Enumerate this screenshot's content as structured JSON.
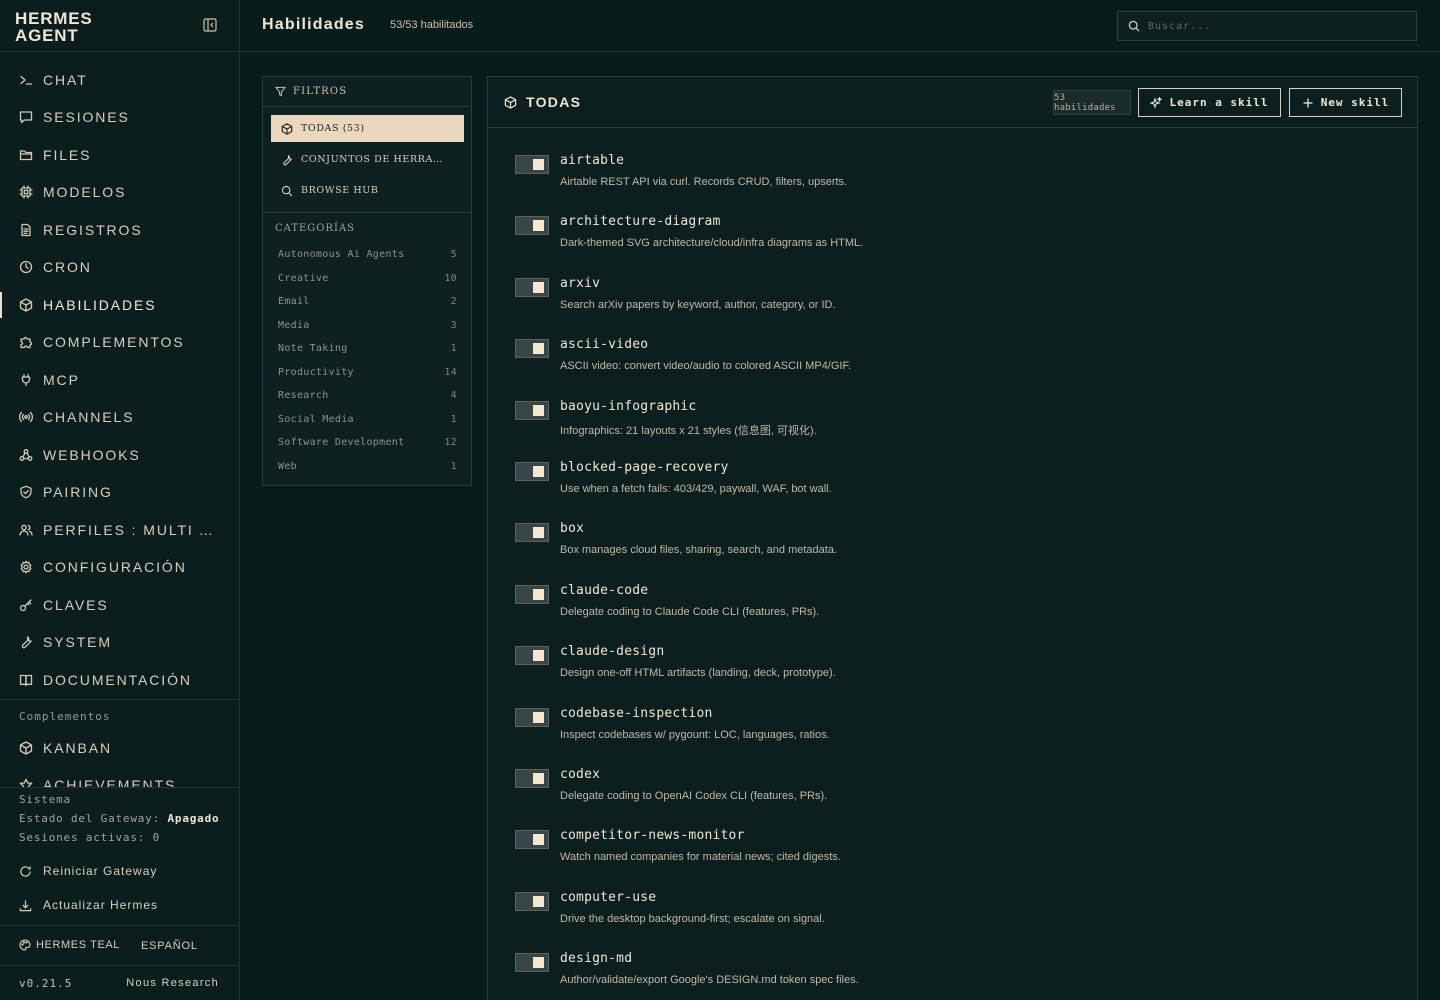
{
  "brand": {
    "line1": "HERMES",
    "line2": "AGENT"
  },
  "nav": [
    {
      "label": "CHAT",
      "icon": "terminal-icon"
    },
    {
      "label": "SESIONES",
      "icon": "message-square-icon"
    },
    {
      "label": "FILES",
      "icon": "folder-icon"
    },
    {
      "label": "MODELOS",
      "icon": "cpu-icon"
    },
    {
      "label": "REGISTROS",
      "icon": "file-text-icon"
    },
    {
      "label": "CRON",
      "icon": "clock-icon"
    },
    {
      "label": "HABILIDADES",
      "icon": "package-icon",
      "active": true
    },
    {
      "label": "COMPLEMENTOS",
      "icon": "puzzle-icon"
    },
    {
      "label": "MCP",
      "icon": "plug-icon"
    },
    {
      "label": "CHANNELS",
      "icon": "radio-icon"
    },
    {
      "label": "WEBHOOKS",
      "icon": "webhook-icon"
    },
    {
      "label": "PAIRING",
      "icon": "shield-check-icon"
    },
    {
      "label": "PERFILES : MULTI AGENTS",
      "icon": "users-icon"
    },
    {
      "label": "CONFIGURACIÓN",
      "icon": "settings-icon"
    },
    {
      "label": "CLAVES",
      "icon": "key-icon"
    },
    {
      "label": "SYSTEM",
      "icon": "wrench-icon"
    },
    {
      "label": "DOCUMENTACIÓN",
      "icon": "book-icon"
    }
  ],
  "plugins": {
    "heading": "Complementos",
    "items": [
      {
        "label": "KANBAN",
        "icon": "package-icon"
      },
      {
        "label": "ACHIEVEMENTS",
        "icon": "star-icon"
      }
    ]
  },
  "system": {
    "heading": "Sistema",
    "gateway_label": "Estado del Gateway:",
    "gateway_value": "Apagado",
    "sessions_label": "Sesiones activas:",
    "sessions_value": "0",
    "restart_label": "Reiniciar Gateway",
    "update_label": "Actualizar Hermes"
  },
  "footer": {
    "theme": "HERMES TEAL",
    "language": "ESPAÑOL",
    "version": "v0.21.5",
    "vendor": "Nous Research"
  },
  "header": {
    "title": "Habilidades",
    "subtitle": "53/53 habilitados",
    "search_placeholder": "Buscar..."
  },
  "filters": {
    "heading": "FILTROS",
    "options": [
      {
        "label": "TODAS (53)",
        "icon": "package-icon",
        "selected": true
      },
      {
        "label": "CONJUNTOS DE HERRAMIENTAS",
        "icon": "wrench-icon"
      },
      {
        "label": "BROWSE HUB",
        "icon": "search-icon"
      }
    ],
    "categories_heading": "CATEGORÍAS",
    "categories": [
      {
        "name": "Autonomous Ai Agents",
        "count": "5"
      },
      {
        "name": "Creative",
        "count": "10"
      },
      {
        "name": "Email",
        "count": "2"
      },
      {
        "name": "Media",
        "count": "3"
      },
      {
        "name": "Note Taking",
        "count": "1"
      },
      {
        "name": "Productivity",
        "count": "14"
      },
      {
        "name": "Research",
        "count": "4"
      },
      {
        "name": "Social Media",
        "count": "1"
      },
      {
        "name": "Software Development",
        "count": "12"
      },
      {
        "name": "Web",
        "count": "1"
      }
    ]
  },
  "skills_panel": {
    "title": "TODAS",
    "count_badge": "53 habilidades",
    "learn_label": "Learn a skill",
    "new_label": "New skill",
    "skills": [
      {
        "name": "airtable",
        "desc": "Airtable REST API via curl. Records CRUD, filters, upserts.",
        "enabled": true
      },
      {
        "name": "architecture-diagram",
        "desc": "Dark-themed SVG architecture/cloud/infra diagrams as HTML.",
        "enabled": true
      },
      {
        "name": "arxiv",
        "desc": "Search arXiv papers by keyword, author, category, or ID.",
        "enabled": true
      },
      {
        "name": "ascii-video",
        "desc": "ASCII video: convert video/audio to colored ASCII MP4/GIF.",
        "enabled": true
      },
      {
        "name": "baoyu-infographic",
        "desc": "Infographics: 21 layouts x 21 styles (信息图, 可视化).",
        "enabled": true
      },
      {
        "name": "blocked-page-recovery",
        "desc": "Use when a fetch fails: 403/429, paywall, WAF, bot wall.",
        "enabled": true
      },
      {
        "name": "box",
        "desc": "Box manages cloud files, sharing, search, and metadata.",
        "enabled": true
      },
      {
        "name": "claude-code",
        "desc": "Delegate coding to Claude Code CLI (features, PRs).",
        "enabled": true
      },
      {
        "name": "claude-design",
        "desc": "Design one-off HTML artifacts (landing, deck, prototype).",
        "enabled": true
      },
      {
        "name": "codebase-inspection",
        "desc": "Inspect codebases w/ pygount: LOC, languages, ratios.",
        "enabled": true
      },
      {
        "name": "codex",
        "desc": "Delegate coding to OpenAI Codex CLI (features, PRs).",
        "enabled": true
      },
      {
        "name": "competitor-news-monitor",
        "desc": "Watch named companies for material news; cited digests.",
        "enabled": true
      },
      {
        "name": "computer-use",
        "desc": "Drive the desktop background-first; escalate on signal.",
        "enabled": true
      },
      {
        "name": "design-md",
        "desc": "Author/validate/export Google's DESIGN.md token spec files.",
        "enabled": true
      }
    ]
  }
}
